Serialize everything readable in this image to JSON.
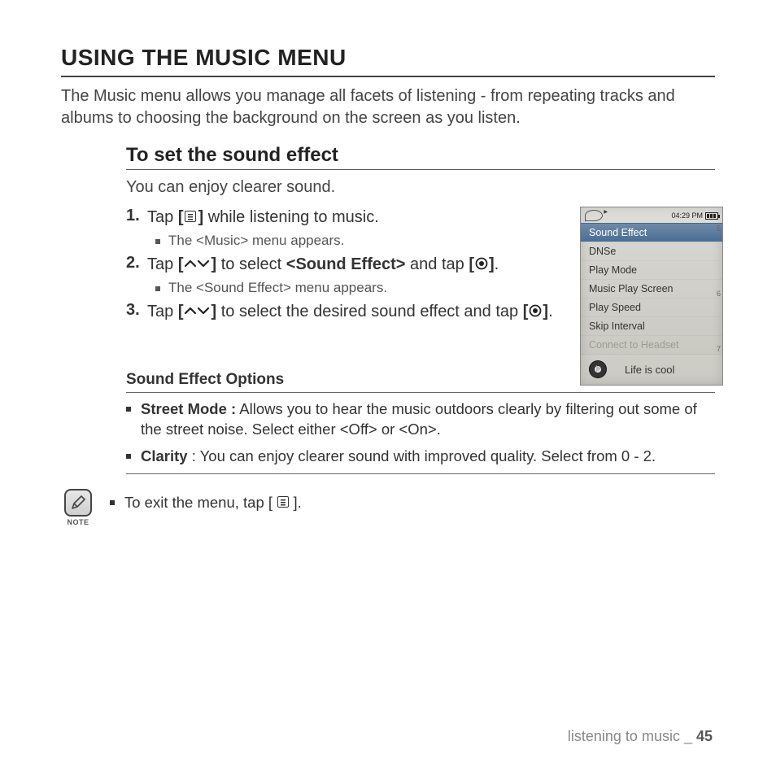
{
  "heading": "USING THE MUSIC MENU",
  "intro": "The Music menu allows you manage all facets of listening - from repeating tracks and albums to choosing the background on the screen as you listen.",
  "section_title": "To set the sound effect",
  "section_intro": "You can enjoy clearer sound.",
  "steps": [
    {
      "num": "1.",
      "pre": "Tap ",
      "b1": "[",
      "icon": "menu",
      "b2": "]",
      "post": " while listening to music.",
      "sub": "The <Music> menu appears."
    },
    {
      "num": "2.",
      "pre": "Tap ",
      "b1": "[",
      "icon": "updown",
      "b2": "]",
      "mid": " to select ",
      "bold_mid": "<Sound Effect>",
      "mid2": " and tap ",
      "b3": "[",
      "icon2": "target",
      "b4": "]",
      "post": ".",
      "sub": "The <Sound Effect> menu appears."
    },
    {
      "num": "3.",
      "pre": "Tap ",
      "b1": "[",
      "icon": "updown",
      "b2": "]",
      "mid": " to select the desired sound effect and tap ",
      "b3": "[",
      "icon2": "target",
      "b4": "]",
      "post": "."
    }
  ],
  "device": {
    "time": "04:29 PM",
    "menu": [
      {
        "label": "Sound Effect",
        "state": "sel"
      },
      {
        "label": "DNSe",
        "state": ""
      },
      {
        "label": "Play Mode",
        "state": ""
      },
      {
        "label": "Music Play Screen",
        "state": ""
      },
      {
        "label": "Play Speed",
        "state": ""
      },
      {
        "label": "Skip Interval",
        "state": ""
      },
      {
        "label": "Connect to Headset",
        "state": "disabled"
      }
    ],
    "nowplaying": "Life is cool"
  },
  "options_heading": "Sound Effect Options",
  "options": [
    {
      "bold": "Street Mode :",
      "text": " Allows you to hear the music outdoors clearly by  filtering out some of the street noise. Select either <Off> or <On>."
    },
    {
      "bold": "Clarity",
      "text": " : You can enjoy clearer sound with improved quality. Select from 0 - 2."
    }
  ],
  "note_label": "NOTE",
  "note_pre": "To exit the menu, tap [ ",
  "note_post": " ].",
  "footer_text": "listening to music _ ",
  "footer_page": "45"
}
